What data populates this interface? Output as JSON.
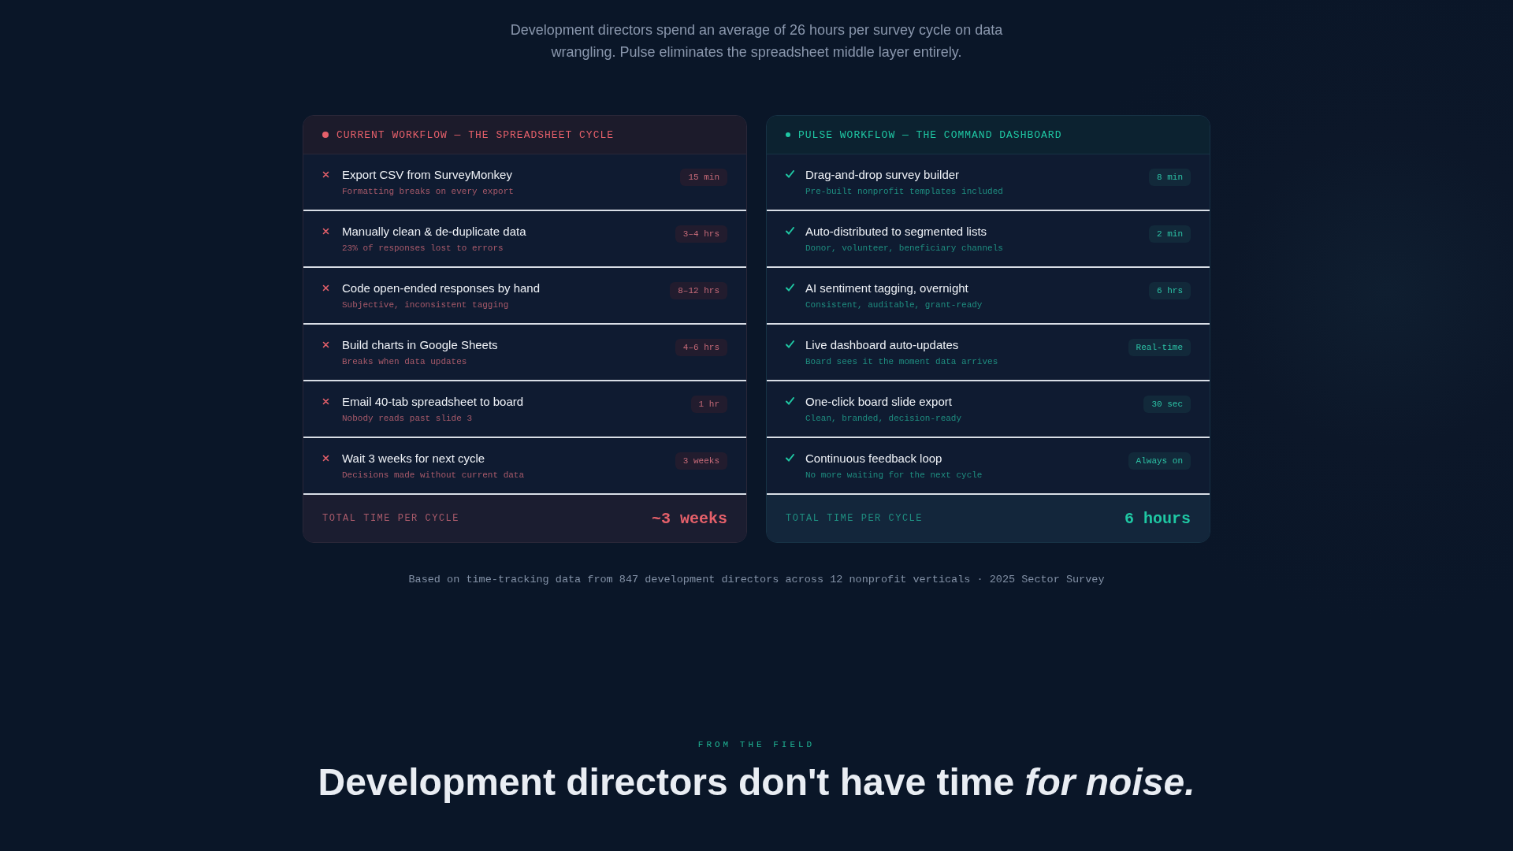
{
  "intro": "Development directors spend an average of 26 hours per survey cycle on data wrangling. Pulse eliminates the spreadsheet middle layer entirely.",
  "columns": [
    {
      "kind": "current",
      "title": "CURRENT WORKFLOW — THE SPREADSHEET CYCLE",
      "steps": [
        {
          "title": "Export CSV from SurveyMonkey",
          "note": "Formatting breaks on every export",
          "time": "15 min"
        },
        {
          "title": "Manually clean & de-duplicate data",
          "note": "23% of responses lost to errors",
          "time": "3–4 hrs"
        },
        {
          "title": "Code open-ended responses by hand",
          "note": "Subjective, inconsistent tagging",
          "time": "8–12 hrs"
        },
        {
          "title": "Build charts in Google Sheets",
          "note": "Breaks when data updates",
          "time": "4–6 hrs"
        },
        {
          "title": "Email 40-tab spreadsheet to board",
          "note": "Nobody reads past slide 3",
          "time": "1 hr"
        },
        {
          "title": "Wait 3 weeks for next cycle",
          "note": "Decisions made without current data",
          "time": "3 weeks"
        }
      ],
      "total_label": "TOTAL TIME PER CYCLE",
      "total": "~3 weeks"
    },
    {
      "kind": "pulse",
      "title": "PULSE WORKFLOW — THE COMMAND DASHBOARD",
      "steps": [
        {
          "title": "Drag-and-drop survey builder",
          "note": "Pre-built nonprofit templates included",
          "time": "8 min"
        },
        {
          "title": "Auto-distributed to segmented lists",
          "note": "Donor, volunteer, beneficiary channels",
          "time": "2 min"
        },
        {
          "title": "AI sentiment tagging, overnight",
          "note": "Consistent, auditable, grant-ready",
          "time": "6 hrs"
        },
        {
          "title": "Live dashboard auto-updates",
          "note": "Board sees it the moment data arrives",
          "time": "Real-time"
        },
        {
          "title": "One-click board slide export",
          "note": "Clean, branded, decision-ready",
          "time": "30 sec"
        },
        {
          "title": "Continuous feedback loop",
          "note": "No more waiting for the next cycle",
          "time": "Always on"
        }
      ],
      "total_label": "TOTAL TIME PER CYCLE",
      "total": "6 hours"
    }
  ],
  "source": "Based on time-tracking data from 847 development directors across 12 nonprofit verticals · 2025 Sector Survey",
  "next_section": {
    "eyebrow": "FROM THE FIELD",
    "heading": "Development directors don't have time *for noise.*"
  }
}
